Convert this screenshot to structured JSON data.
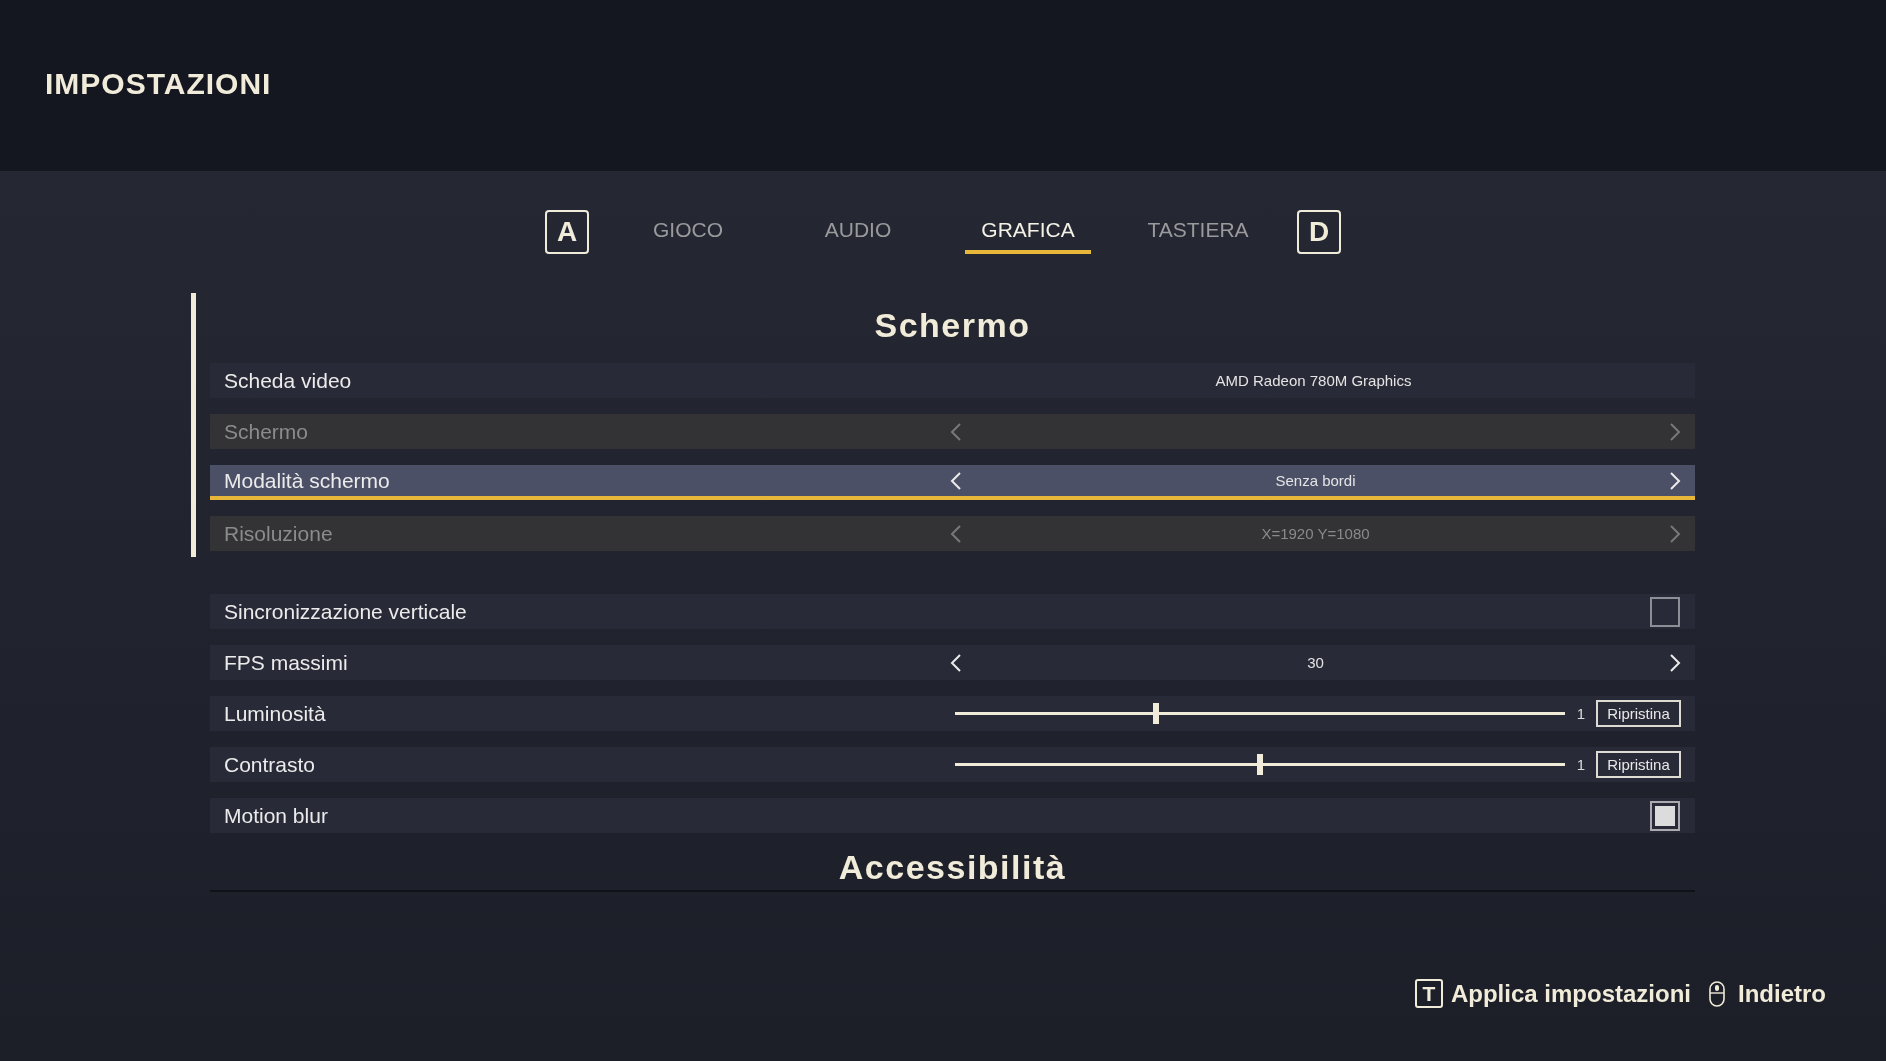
{
  "title": "IMPOSTAZIONI",
  "tab_bar": {
    "prev_key": "A",
    "next_key": "D",
    "tabs": [
      {
        "label": "GIOCO",
        "selected": false
      },
      {
        "label": "AUDIO",
        "selected": false
      },
      {
        "label": "GRAFICA",
        "selected": true
      },
      {
        "label": "TASTIERA",
        "selected": false
      }
    ]
  },
  "sections": [
    {
      "title": "Schermo",
      "groups": [
        {
          "focused": true,
          "rows": [
            {
              "kind": "info",
              "label": "Scheda video",
              "value": "AMD Radeon 780M Graphics",
              "selected": false,
              "disabled": false
            },
            {
              "kind": "selector",
              "label": "Schermo",
              "selected": false,
              "disabled": true
            },
            {
              "kind": "selector",
              "label": "Modalità schermo",
              "value": "Senza bordi",
              "selected": true,
              "disabled": false
            },
            {
              "kind": "selector",
              "label": "Risoluzione",
              "value": "X=1920 Y=1080",
              "selected": false,
              "disabled": true
            }
          ]
        },
        {
          "focused": false,
          "rows": [
            {
              "kind": "checkbox",
              "label": "Sincronizzazione verticale",
              "checked": false,
              "selected": false,
              "disabled": false
            },
            {
              "kind": "selector",
              "label": "FPS massimi",
              "value": "30",
              "selected": false,
              "disabled": false
            },
            {
              "kind": "slider",
              "label": "Luminosità",
              "level": 0.33,
              "reading": "1",
              "reset": "Ripristina",
              "selected": false,
              "disabled": false
            },
            {
              "kind": "slider",
              "label": "Contrasto",
              "level": 0.5,
              "reading": "1",
              "reset": "Ripristina",
              "selected": false,
              "disabled": false
            },
            {
              "kind": "checkbox",
              "label": "Motion blur",
              "checked": true,
              "selected": false,
              "disabled": false
            }
          ]
        }
      ]
    },
    {
      "title": "Accessibilità"
    }
  ],
  "footer_actions": [
    {
      "kind": "key",
      "key": "T",
      "label": "Applica impostazioni"
    },
    {
      "kind": "mouse",
      "label": "Indietro"
    }
  ]
}
